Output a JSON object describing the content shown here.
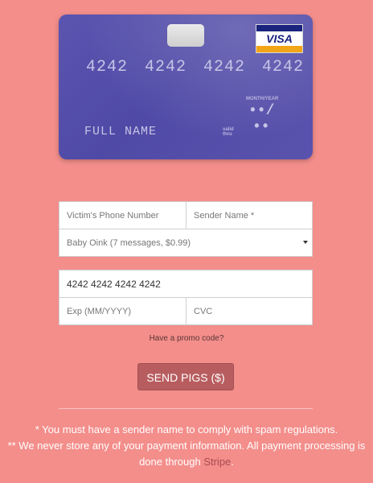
{
  "card": {
    "number": "4242 4242 4242 4242",
    "name": "FULL NAME",
    "brand": "VISA",
    "month_year_label": "MONTH/YEAR",
    "valid_thru": "valid thru",
    "exp_top": "••/",
    "exp_bottom": "••",
    "colors": {
      "card": "#5250a8",
      "brand_blue": "#1a237e",
      "brand_gold": "#f2a516"
    }
  },
  "form": {
    "phone_placeholder": "Victim's Phone Number",
    "sender_placeholder": "Sender Name *",
    "package_selected": "Baby Oink (7 messages, $0.99)",
    "card_number_value": "4242 4242 4242 4242",
    "exp_placeholder": "Exp (MM/YYYY)",
    "cvc_placeholder": "CVC",
    "promo_link": "Have a promo code?",
    "submit_label": "SEND PIGS ($)"
  },
  "footer": {
    "note1": "* You must have a sender name to comply with spam regulations.",
    "note2": "** We never store any of your payment information. All payment processing is",
    "note3_prefix": "done through ",
    "note3_link": "Stripe",
    "note3_suffix": "."
  },
  "colors": {
    "background": "#f38e8b",
    "button": "#b85d5f"
  }
}
